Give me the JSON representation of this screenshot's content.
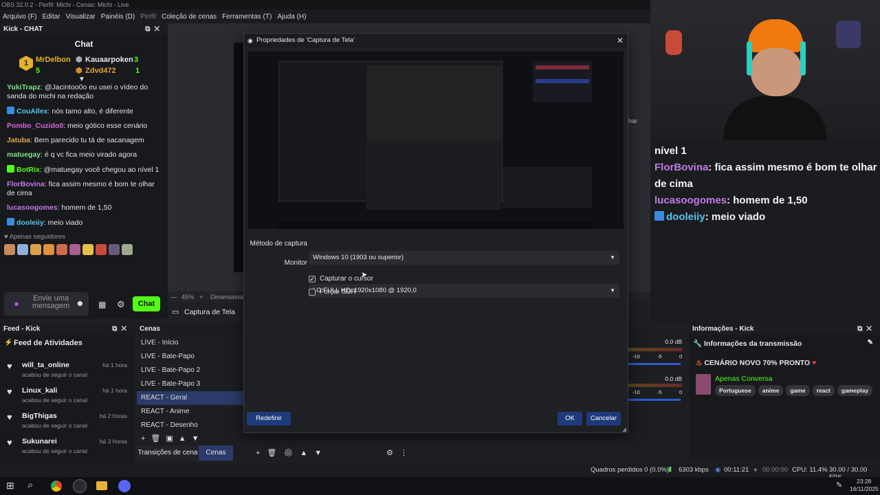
{
  "window": {
    "title": "OBS 32.0.2 - Perfil: Michi - Cenas: Michi - Live"
  },
  "menu": [
    "Arquivo (F)",
    "Editar",
    "Visualizar",
    "Painéis (D)",
    "Perfil",
    "Coleção de cenas",
    "Ferramentas (T)",
    "Ajuda (H)"
  ],
  "chat_dock": {
    "header": "Kick - CHAT",
    "title": "Chat",
    "leaderboard": {
      "first": {
        "rank": "1",
        "name": "MrDelbon",
        "count": "5"
      },
      "second": {
        "name": "Kauaarpoken",
        "count": "3"
      },
      "third": {
        "name": "Zdvd472",
        "count": "1"
      }
    },
    "messages": [
      {
        "user": "YukiTrapz",
        "user_color": "#7ee08a",
        "text": ": @Jacintoo0o eu usei o vídeo do sanda do michi na redação"
      },
      {
        "user": "CouAllex",
        "user_color": "#56c4f0",
        "text": ": nós tamo alto, é diferente"
      },
      {
        "user": "Pombo_Cuzido0",
        "user_color": "#d46ad6",
        "text": ": meio gótico esse cenário"
      },
      {
        "user": "Jatuba",
        "user_color": "#e0a84c",
        "text": ": Bem parecido tu tá de sacanagem"
      },
      {
        "user": "matuegay",
        "user_color": "#7ee08a",
        "text": ": é q vc fica meio virado agora"
      },
      {
        "user": "BotRix",
        "user_color": "#53fc18",
        "text": ": @matuegay você chegou ao nível 1"
      },
      {
        "user": "FlorBovina",
        "user_color": "#c07ae8",
        "text": ": fica assim mesmo é bom te olhar de cima"
      },
      {
        "user": "lucasoogomes",
        "user_color": "#c07ae8",
        "text": ": homem de 1,50"
      },
      {
        "user": "dooleiiy",
        "user_color": "#56c4f0",
        "text": ": meio viado"
      }
    ],
    "followers_note": "Apenas seguidores",
    "input_placeholder": "Envie uma mensagem",
    "send_label": "Chat"
  },
  "preview": {
    "zoom": "45%",
    "dimension_label": "Dimensionad"
  },
  "capture_source": "Captura de Tela",
  "feed_dock": {
    "header": "Feed - Kick",
    "title": "Feed de Atividades",
    "items": [
      {
        "name": "will_ta_online",
        "sub": "acabou de seguir o canal",
        "time": "há 1 hora"
      },
      {
        "name": "Linux_kali",
        "sub": "acabou de seguir o canal",
        "time": "há 1 hora"
      },
      {
        "name": "BigThigas",
        "sub": "acabou de seguir o canal",
        "time": "há 2 horas"
      },
      {
        "name": "Sukunarei",
        "sub": "acabou de seguir o canal",
        "time": "há 3 horas"
      }
    ]
  },
  "scenes_dock": {
    "header": "Cenas",
    "scenes": [
      "LIVE - Início",
      "LIVE - Bate-Papo",
      "LIVE - Bate-Papo 2",
      "LIVE - Bate-Papo 3",
      "REACT - Geral",
      "REACT - Anime",
      "REACT - Desenho"
    ],
    "selected_index": 4,
    "tabs": [
      "Transições de cena",
      "Cenas"
    ]
  },
  "mixer": {
    "db1": "0.0 dB",
    "db2": "0.0 dB",
    "ticks": [
      "-10",
      "-5",
      "0"
    ]
  },
  "info_dock": {
    "header": "Informações - Kick",
    "title": "Informações da transmissão",
    "stream_title": "CENÁRIO NOVO 70% PRONTO",
    "category": "Apenas Conversa",
    "tags": [
      "Portuguese",
      "anime",
      "game",
      "react",
      "gameplay"
    ]
  },
  "overlay_chat": [
    {
      "user": "",
      "text": "nível 1"
    },
    {
      "user": "FlorBovina",
      "user_color": "#c07ae8",
      "text": ": fica assim mesmo é bom te olhar de cima"
    },
    {
      "user": "lucasoogomes",
      "user_color": "#c07ae8",
      "text": ": homem de 1,50"
    },
    {
      "user": "dooleiiy",
      "user_color": "#56c4f0",
      "text": ": meio viado"
    }
  ],
  "status_bar": {
    "dropped": "Quadros perdidos 0 (0.0%)",
    "bitrate": "6303 kbps",
    "live_time": "00:11:21",
    "rec_time": "00:00:00",
    "cpu": "CPU: 11.4%",
    "fps": "30.00 / 30.00 FPS"
  },
  "taskbar": {
    "time": "23:28",
    "date": "16/11/2025"
  },
  "dialog": {
    "title": "Propriedades de 'Captura de Tela'",
    "method_label": "Método de captura",
    "method_value": "Windows 10 (1903 ou superior)",
    "monitor_label": "Monitor",
    "monitor_value": "LG FULL HD: 1920x1080 @ 1920,0",
    "capture_cursor": "Capturar o cursor",
    "capture_cursor_checked": true,
    "force_sdr": "Forçar SDR",
    "force_sdr_checked": false,
    "reset": "Redefinir",
    "ok": "OK",
    "cancel": "Cancelar"
  },
  "colors": {
    "accent": "#53fc18",
    "selection": "#2a3b6a",
    "dialog_button": "#1f3a7a"
  }
}
